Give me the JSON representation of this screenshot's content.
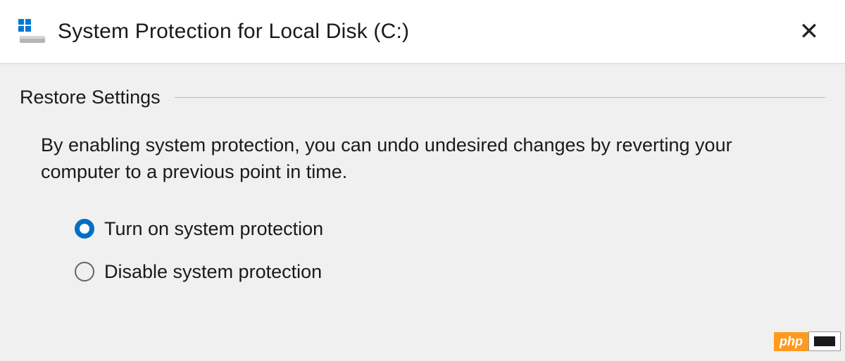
{
  "window": {
    "title": "System Protection for Local Disk (C:)"
  },
  "section": {
    "title": "Restore Settings",
    "description": "By enabling system protection, you can undo undesired changes by reverting your computer to a previous point in time."
  },
  "options": {
    "turn_on": {
      "label": "Turn on system protection",
      "checked": true
    },
    "disable": {
      "label": "Disable system protection",
      "checked": false
    }
  },
  "watermark": {
    "text": "php"
  }
}
